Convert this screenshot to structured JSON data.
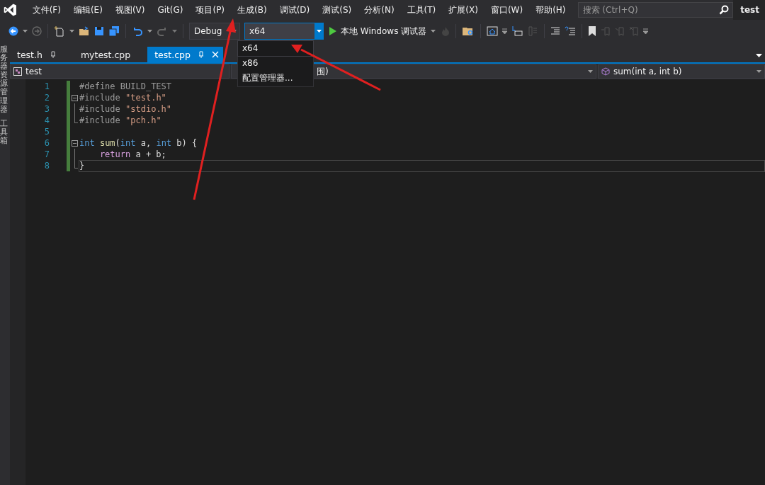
{
  "menu_bar": {
    "items": [
      "文件(F)",
      "编辑(E)",
      "视图(V)",
      "Git(G)",
      "项目(P)",
      "生成(B)",
      "调试(D)",
      "测试(S)",
      "分析(N)",
      "工具(T)",
      "扩展(X)",
      "窗口(W)",
      "帮助(H)"
    ],
    "search": {
      "placeholder": "搜索 (Ctrl+Q)"
    },
    "solution_name": "test"
  },
  "toolbar": {
    "configuration": "Debug",
    "platform": "x64",
    "run_target": "本地 Windows 调试器"
  },
  "platform_menu": {
    "items": [
      {
        "label": "x64",
        "selected": true
      },
      {
        "label": "x86",
        "selected": false
      },
      {
        "label": "配置管理器...",
        "selected": false
      }
    ]
  },
  "side_tabs": [
    "服务器资源管理器",
    "工具箱"
  ],
  "tabs": [
    {
      "label": "test.h",
      "selected": false,
      "pinned": true
    },
    {
      "label": "mytest.cpp",
      "selected": false,
      "pinned": false
    },
    {
      "label": "test.cpp",
      "selected": true,
      "pinned": true
    }
  ],
  "nav_bar": {
    "project": "test",
    "scope": "围)",
    "member": "sum(int a, int b)"
  },
  "code_lines": [
    {
      "number": "1",
      "collapsible": false,
      "outlined": false,
      "block_end": false,
      "current": false,
      "tokens": [
        {
          "kind": "preproc",
          "text": "#define BUILD_TEST"
        }
      ]
    },
    {
      "number": "2",
      "collapsible": true,
      "outlined": false,
      "block_end": false,
      "current": false,
      "tokens": [
        {
          "kind": "preproc",
          "text": "#include "
        },
        {
          "kind": "string",
          "text": "\"test.h\""
        }
      ]
    },
    {
      "number": "3",
      "collapsible": false,
      "outlined": true,
      "block_end": false,
      "current": false,
      "tokens": [
        {
          "kind": "preproc",
          "text": "#include "
        },
        {
          "kind": "string",
          "text": "\"stdio.h\""
        }
      ]
    },
    {
      "number": "4",
      "collapsible": false,
      "outlined": true,
      "block_end": true,
      "current": false,
      "tokens": [
        {
          "kind": "preproc",
          "text": "#include "
        },
        {
          "kind": "string",
          "text": "\"pch.h\""
        }
      ]
    },
    {
      "number": "5",
      "collapsible": false,
      "outlined": false,
      "block_end": false,
      "current": false
    },
    {
      "number": "6",
      "collapsible": true,
      "outlined": false,
      "block_end": false,
      "current": false,
      "tokens": [
        {
          "kind": "keyword",
          "text": "int"
        },
        {
          "kind": "function",
          "text": " sum"
        },
        {
          "kind": "plain",
          "text": "("
        },
        {
          "kind": "keyword",
          "text": "int"
        },
        {
          "kind": "plain",
          "text": " a, "
        },
        {
          "kind": "keyword",
          "text": "int"
        },
        {
          "kind": "plain",
          "text": " b) {"
        }
      ]
    },
    {
      "number": "7",
      "collapsible": false,
      "outlined": true,
      "block_end": false,
      "current": false,
      "tokens": [
        {
          "kind": "control",
          "text": "    return"
        },
        {
          "kind": "plain",
          "text": " a + b;"
        }
      ]
    },
    {
      "number": "8",
      "collapsible": false,
      "outlined": true,
      "block_end": true,
      "current": true,
      "tokens": [
        {
          "kind": "plain",
          "text": "}"
        }
      ]
    }
  ]
}
